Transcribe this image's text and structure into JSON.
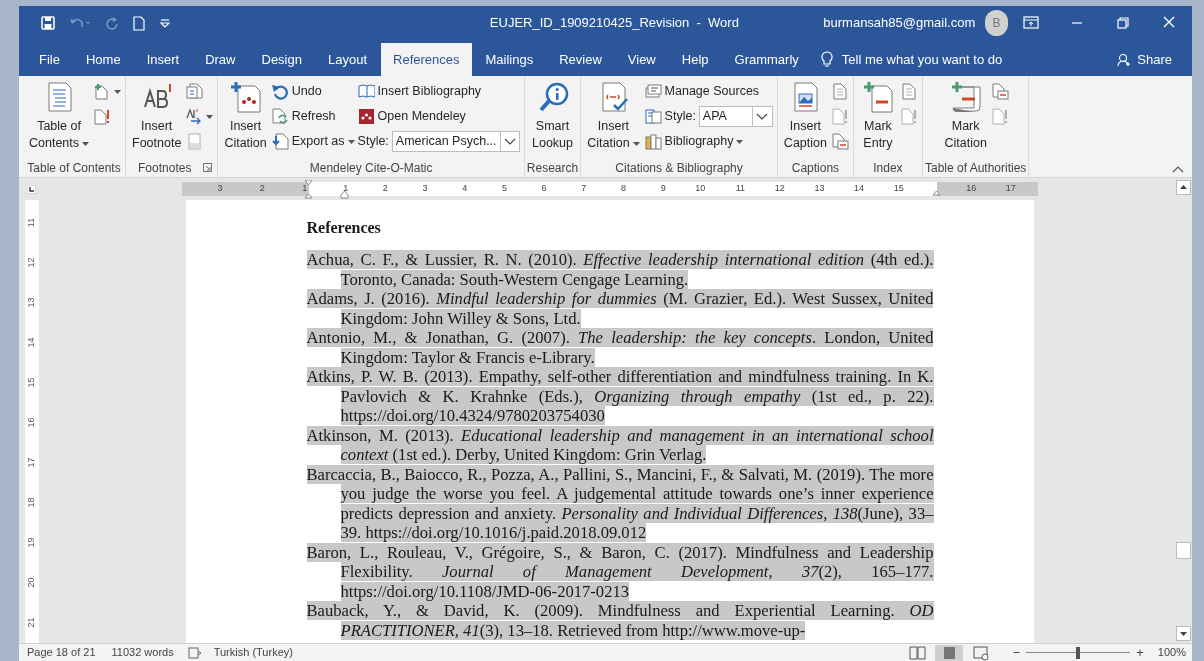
{
  "title_bar": {
    "title": "EUJER_ID_1909210425_Revision  -  Word",
    "account": "burmansah85@gmail.com",
    "avatar_initial": "B"
  },
  "tabs": [
    {
      "label": "File",
      "selected": false
    },
    {
      "label": "Home",
      "selected": false
    },
    {
      "label": "Insert",
      "selected": false
    },
    {
      "label": "Draw",
      "selected": false
    },
    {
      "label": "Design",
      "selected": false
    },
    {
      "label": "Layout",
      "selected": false
    },
    {
      "label": "References",
      "selected": true
    },
    {
      "label": "Mailings",
      "selected": false
    },
    {
      "label": "Review",
      "selected": false
    },
    {
      "label": "View",
      "selected": false
    },
    {
      "label": "Help",
      "selected": false
    },
    {
      "label": "Grammarly",
      "selected": false
    }
  ],
  "tell_me": "Tell me what you want to do",
  "share": "Share",
  "ribbon": {
    "groups": [
      {
        "label": "Table of Contents",
        "launcher": false,
        "columns": [
          {
            "kind": "large",
            "lines": [
              "Table of",
              "Contents"
            ],
            "dropdown": true
          },
          {
            "kind": "stack",
            "items": [
              {
                "kind": "icon",
                "dropdown": true
              },
              {
                "kind": "icon",
                "dropdown": false
              }
            ]
          }
        ]
      },
      {
        "label": "Footnotes",
        "launcher": true,
        "columns": [
          {
            "kind": "large",
            "lines": [
              "Insert",
              "Footnote"
            ],
            "dropdown": false
          },
          {
            "kind": "stack",
            "items": [
              {
                "kind": "icon",
                "dropdown": false
              },
              {
                "kind": "icon",
                "dropdown": true
              },
              {
                "kind": "icon",
                "dropdown": false
              }
            ]
          }
        ]
      },
      {
        "label": "Mendeley Cite-O-Matic",
        "launcher": false,
        "columns": [
          {
            "kind": "large",
            "lines": [
              "Insert",
              "Citation"
            ],
            "dropdown": false
          },
          {
            "kind": "stack",
            "items": [
              {
                "kind": "small",
                "label": "Undo",
                "dropdown": false
              },
              {
                "kind": "small",
                "label": "Refresh",
                "dropdown": false
              },
              {
                "kind": "small",
                "label": "Export as",
                "dropdown": true
              }
            ]
          },
          {
            "kind": "stack",
            "items": [
              {
                "kind": "small",
                "label": "Insert Bibliography",
                "dropdown": false
              },
              {
                "kind": "small",
                "label": "Open Mendeley",
                "dropdown": false
              },
              {
                "kind": "combo",
                "label": "Style:",
                "value": "American Psych..."
              }
            ]
          }
        ]
      },
      {
        "label": "Research",
        "launcher": false,
        "columns": [
          {
            "kind": "large",
            "lines": [
              "Smart",
              "Lookup"
            ],
            "dropdown": false
          }
        ]
      },
      {
        "label": "Citations & Bibliography",
        "launcher": false,
        "columns": [
          {
            "kind": "large",
            "lines": [
              "Insert",
              "Citation"
            ],
            "dropdown": true
          },
          {
            "kind": "stack",
            "items": [
              {
                "kind": "small",
                "label": "Manage Sources",
                "dropdown": false
              },
              {
                "kind": "combo",
                "label": "Style:",
                "value": "APA"
              },
              {
                "kind": "small",
                "label": "Bibliography",
                "dropdown": true
              }
            ]
          }
        ]
      },
      {
        "label": "Captions",
        "launcher": false,
        "columns": [
          {
            "kind": "large",
            "lines": [
              "Insert",
              "Caption"
            ],
            "dropdown": false
          },
          {
            "kind": "stack",
            "items": [
              {
                "kind": "icon",
                "dropdown": false
              },
              {
                "kind": "icon",
                "dropdown": false
              },
              {
                "kind": "icon",
                "dropdown": false
              }
            ]
          }
        ]
      },
      {
        "label": "Index",
        "launcher": false,
        "columns": [
          {
            "kind": "large",
            "lines": [
              "Mark",
              "Entry"
            ],
            "dropdown": false
          },
          {
            "kind": "stack",
            "items": [
              {
                "kind": "icon",
                "dropdown": false
              },
              {
                "kind": "icon",
                "dropdown": false
              }
            ]
          }
        ]
      },
      {
        "label": "Table of Authorities",
        "launcher": false,
        "columns": [
          {
            "kind": "large",
            "lines": [
              "Mark",
              "Citation"
            ],
            "dropdown": false
          },
          {
            "kind": "stack",
            "items": [
              {
                "kind": "icon",
                "dropdown": false
              },
              {
                "kind": "icon",
                "dropdown": false
              }
            ]
          }
        ]
      }
    ]
  },
  "ruler": {
    "left_margin_marks": [
      "3",
      "2",
      "1"
    ],
    "marks": [
      "1",
      "2",
      "3",
      "4",
      "5",
      "6",
      "7",
      "8",
      "9",
      "10",
      "11",
      "12",
      "13",
      "14",
      "15"
    ],
    "right_margin_marks": [
      "16",
      "17"
    ]
  },
  "vertical_ruler": [
    "11",
    "12",
    "13",
    "14",
    "15",
    "16",
    "17",
    "18",
    "19",
    "20",
    "21"
  ],
  "document": {
    "heading": "References",
    "entries": [
      "Achua, C. F., & Lussier, R. N. (2010). *Effective leadership international edition* (4th ed.). Toronto, Canada: South-Western Cengage Learning.",
      "Adams, J. (2016). *Mindful leadership for dummies* (M. Grazier, Ed.). West Sussex, United Kingdom: John Willey & Sons, Ltd.",
      "Antonio, M., & Jonathan, G. (2007). *The leadership: the key concepts*. London, United Kingdom: Taylor & Francis e-Library.",
      "Atkins, P. W. B. (2013). Empathy, self-other differentiation and mindfulness training. In K. Pavlovich & K. Krahnke (Eds.), *Organizing through empathy* (1st ed., p. 22). https://doi.org/10.4324/9780203754030",
      "Atkinson, M. (2013). *Educational leadership and management in an international school context* (1st ed.). Derby, United Kingdom: Grin Verlag.",
      "Barcaccia, B., Baiocco, R., Pozza, A., Pallini, S., Mancini, F., & Salvati, M. (2019). The more you judge the worse you feel. A judgemental attitude towards one’s inner experience predicts depression and anxiety. *Personality and Individual Differences*, *138*(June), 33–39. https://doi.org/10.1016/j.paid.2018.09.012",
      "Baron, L., Rouleau, V., Grégoire, S., & Baron, C. (2017). Mindfulness and Leadership Flexibility. *Journal of Management Development*, *37*(2), 165–177. https://doi.org/10.1108/JMD-06-2017-0213",
      "Bauback, Y., & David, K. (2009). Mindfulness and Experiential Learning. *OD PRACTITIONER, 41*(3), 13–18. Retrieved from http://www.move-up-"
    ]
  },
  "status_bar": {
    "page": "Page 18 of 21",
    "words": "11032 words",
    "language": "Turkish (Turkey)",
    "views": [
      {
        "selected": false
      },
      {
        "selected": true
      },
      {
        "selected": false
      }
    ],
    "zoom": {
      "minus": "−",
      "plus": "+",
      "level": 0.5,
      "reading": "100%"
    }
  }
}
